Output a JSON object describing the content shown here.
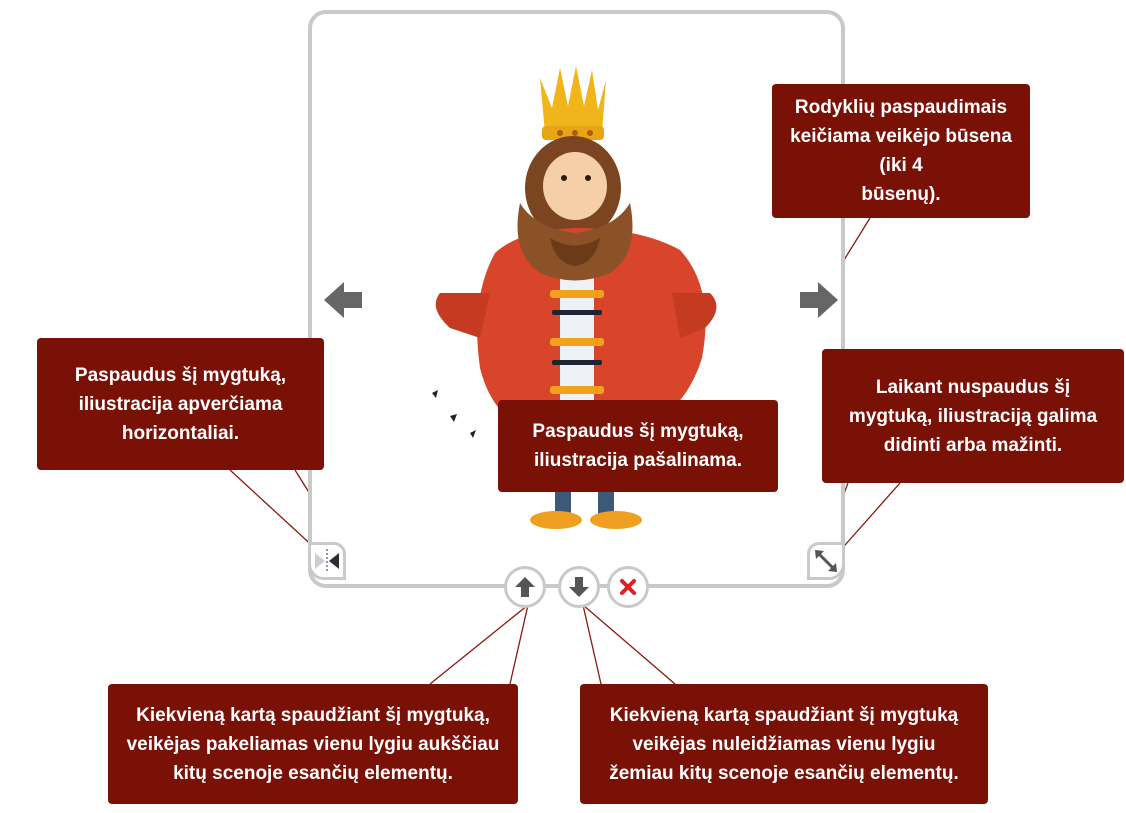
{
  "callouts": {
    "state_arrows": "Rodyklių paspaudimais\nkeičiama veikėjo būsena (iki 4\nbūsenų).",
    "flip": "Paspaudus šį mygtuką,\niliustracija apverčiama\nhorizontaliai.",
    "remove": "Paspaudus šį mygtuką,\niliustracija pašalinama.",
    "resize": "Laikant nuspaudus šį\nmygtuką, iliustraciją galima\ndidinti arba mažinti.",
    "raise_layer": "Kiekvieną kartą spaudžiant šį mygtuką,\nveikėjas pakeliamas vienu lygiu aukščiau\nkitų scenoje esančių elementų.",
    "lower_layer": "Kiekvieną kartą spaudžiant šį mygtuką\nveikėjas nuleidžiamas vienu lygiu\nžemiau kitų scenoje esančių elementų."
  },
  "colors": {
    "callout_bg": "#7a1107",
    "frame_border": "#c9c9c9",
    "arrow_gray": "#666666",
    "delete_red": "#e02020"
  },
  "icons": [
    "prev-state-arrow-icon",
    "next-state-arrow-icon",
    "flip-horizontal-icon",
    "resize-icon",
    "move-up-icon",
    "move-down-icon",
    "delete-x-icon",
    "king-character"
  ]
}
